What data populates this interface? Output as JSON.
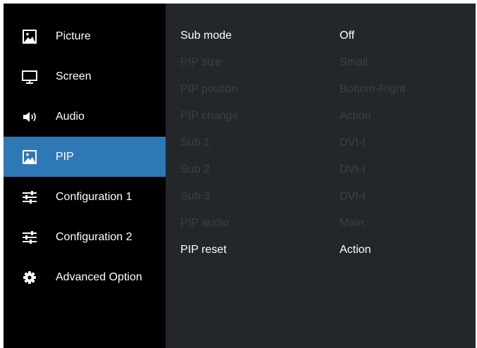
{
  "sidebar": {
    "items": [
      {
        "label": "Picture",
        "icon": "picture-icon",
        "active": false
      },
      {
        "label": "Screen",
        "icon": "monitor-icon",
        "active": false
      },
      {
        "label": "Audio",
        "icon": "speaker-icon",
        "active": false
      },
      {
        "label": "PIP",
        "icon": "picture-icon",
        "active": true
      },
      {
        "label": "Configuration 1",
        "icon": "sliders-icon",
        "active": false
      },
      {
        "label": "Configuration 2",
        "icon": "sliders-icon",
        "active": false
      },
      {
        "label": "Advanced Option",
        "icon": "gear-icon",
        "active": false
      }
    ]
  },
  "settings": {
    "rows": [
      {
        "label": "Sub mode",
        "value": "Off",
        "enabled": true
      },
      {
        "label": "PIP size",
        "value": "Small",
        "enabled": false
      },
      {
        "label": "PIP positon",
        "value": "Bottom-Right",
        "enabled": false
      },
      {
        "label": "PIP change",
        "value": "Action",
        "enabled": false
      },
      {
        "label": "Sub 1",
        "value": "DVI-I",
        "enabled": false
      },
      {
        "label": "Sub 2",
        "value": "DVI-I",
        "enabled": false
      },
      {
        "label": "Sub 3",
        "value": "DVI-I",
        "enabled": false
      },
      {
        "label": "PIP audio",
        "value": "Main",
        "enabled": false
      },
      {
        "label": "PIP reset",
        "value": "Action",
        "enabled": true
      }
    ]
  },
  "colors": {
    "sidebar_bg": "#000000",
    "panel_bg": "#23272b",
    "active_bg": "#2f78b6",
    "text": "#ffffff",
    "disabled_text": "#3b4046"
  }
}
